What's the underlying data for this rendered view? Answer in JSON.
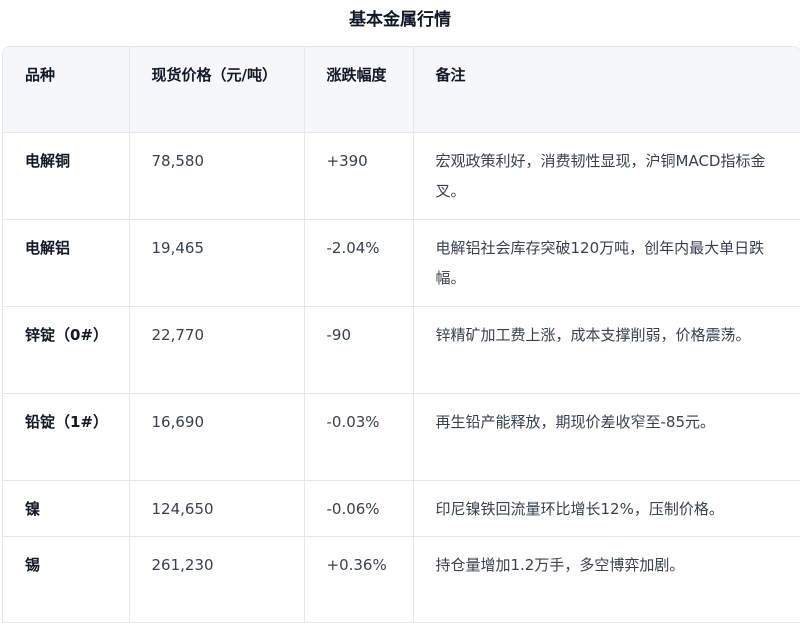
{
  "title": "基本金属行情",
  "headers": [
    "品种",
    "现货价格（元/吨）",
    "涨跌幅度",
    "备注"
  ],
  "rows": [
    {
      "name": "电解铜",
      "price": "78,580",
      "change": "+390",
      "note": "宏观政策利好，消费韧性显现，沪铜MACD指标金叉。"
    },
    {
      "name": "电解铝",
      "price": "19,465",
      "change": "-2.04%",
      "note": "电解铝社会库存突破120万吨，创年内最大单日跌幅。"
    },
    {
      "name": "锌锭（0#）",
      "price": "22,770",
      "change": "-90",
      "note": "锌精矿加工费上涨，成本支撑削弱，价格震荡。"
    },
    {
      "name": "铅锭（1#）",
      "price": "16,690",
      "change": "-0.03%",
      "note": "再生铅产能释放，期现价差收窄至-85元。"
    },
    {
      "name": "镍",
      "price": "124,650",
      "change": "-0.06%",
      "note": "印尼镍铁回流量环比增长12%，压制价格。"
    },
    {
      "name": "锡",
      "price": "261,230",
      "change": "+0.36%",
      "note": "持仓量增加1.2万手，多空博弈加剧。"
    }
  ]
}
